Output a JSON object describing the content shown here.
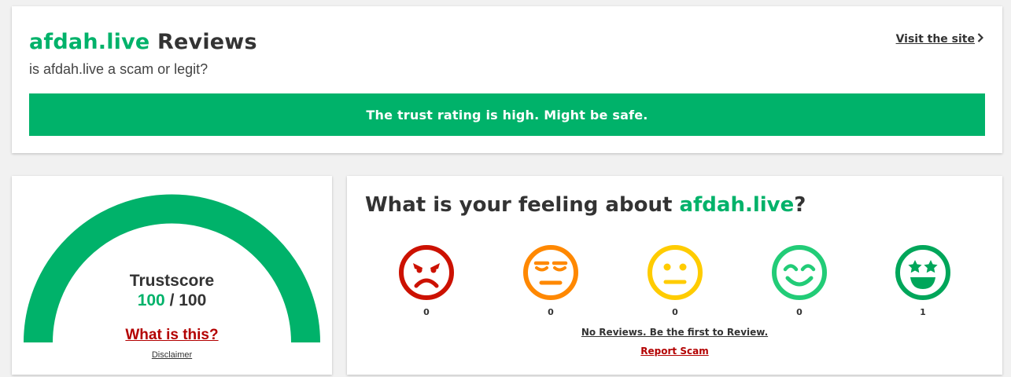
{
  "header": {
    "domain": "afdah.live",
    "title_suffix": "Reviews",
    "subtitle": "is afdah.live a scam or legit?",
    "visit_label": "Visit the site"
  },
  "trust_banner": {
    "text": "The trust rating is high. Might be safe.",
    "color": "#00b26a"
  },
  "trustscore": {
    "label": "Trustscore",
    "score": "100",
    "separator": " / ",
    "max": "100",
    "gauge_fill_fraction": 1.0,
    "gauge_color": "#00b26a",
    "what_label": "What is this?",
    "disclaimer_label": "Disclaimer"
  },
  "feeling": {
    "title_prefix": "What is your feeling about ",
    "domain": "afdah.live",
    "title_suffix": "?",
    "ratings": [
      {
        "icon": "angry-face-icon",
        "color": "#cc1100",
        "count": "0"
      },
      {
        "icon": "annoyed-face-icon",
        "color": "#ff8800",
        "count": "0"
      },
      {
        "icon": "neutral-face-icon",
        "color": "#ffcc00",
        "count": "0"
      },
      {
        "icon": "smiling-face-icon",
        "color": "#22cc77",
        "count": "0"
      },
      {
        "icon": "star-eyes-face-icon",
        "color": "#00a65a",
        "count": "1"
      }
    ],
    "no_reviews_label": "No Reviews. Be the first to Review.",
    "report_label": "Report Scam"
  }
}
